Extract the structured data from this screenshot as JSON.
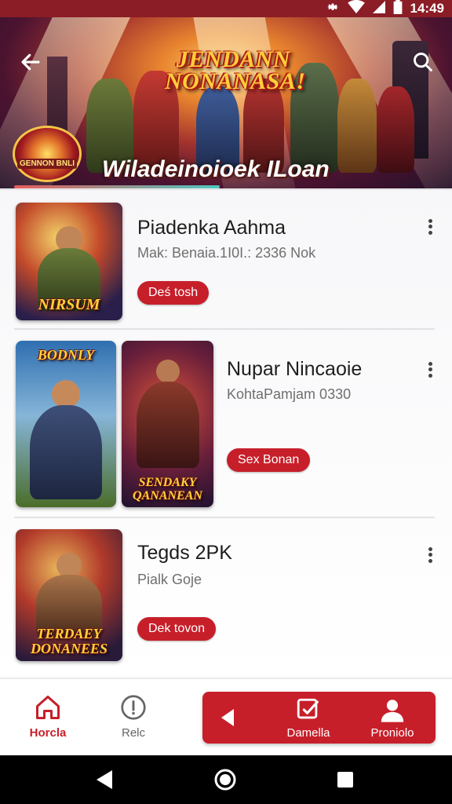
{
  "status_bar": {
    "time": "14:49",
    "icons": [
      "settings-icon",
      "wifi-icon",
      "signal-icon",
      "battery-icon"
    ]
  },
  "hero": {
    "title": "JENDANN NONANASA!",
    "subtitle": "Wiladeinoioek ILoan",
    "emblem_text": "GENNON BNLI",
    "back_icon": "back-arrow-icon",
    "search_icon": "search-icon"
  },
  "items": [
    {
      "title": "Piadenka Aahma",
      "subtitle": "Mak: Benaia.1I0I.: 2336 Nok",
      "button": "Deś tosh",
      "thumb_labels": [
        "NIRSUM"
      ]
    },
    {
      "title": "Nupar Nincaoie",
      "subtitle": "KohtaPamjam 0330",
      "button": "Sex Bonan",
      "thumb_labels": [
        "BODNLY",
        "SENDAKY QANANEAN"
      ]
    },
    {
      "title": "Tegds 2PK",
      "subtitle": "Pialk Goje",
      "button": "Dek tovon",
      "thumb_labels": [
        "TERDAEY DONANEES"
      ]
    }
  ],
  "bottom_nav": {
    "items": [
      {
        "label": "Horcla",
        "icon": "home-icon"
      },
      {
        "label": "Relc",
        "icon": "info-icon"
      },
      {
        "label": "Damella",
        "icon": "edit-icon"
      },
      {
        "label": "Proniolo",
        "icon": "person-icon"
      }
    ],
    "back_icon": "play-left-icon"
  },
  "colors": {
    "accent": "#c71f2a",
    "status_bar": "#8a1d26",
    "active_nav": "#c71f2a"
  }
}
